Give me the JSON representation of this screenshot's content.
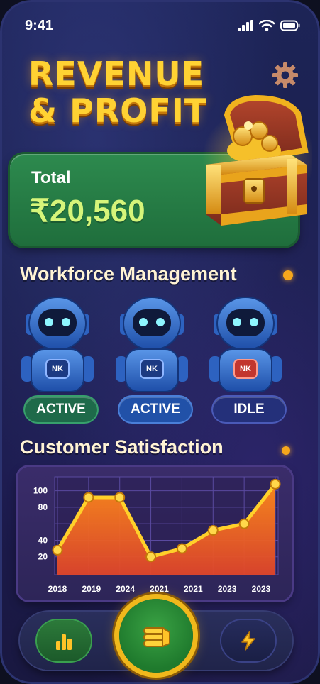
{
  "status_bar": {
    "time": "9:41"
  },
  "hero": {
    "title_line1": "REVENUE",
    "title_line2": "& PROFIT"
  },
  "total_card": {
    "label": "Total",
    "value": "₹20,560"
  },
  "workforce": {
    "title": "Workforce Management",
    "robots": [
      {
        "badge": "NK",
        "status": "ACTIVE",
        "status_color": "#1e6a4a",
        "badge_color": "#2c5fbf"
      },
      {
        "badge": "NK",
        "status": "ACTIVE",
        "status_color": "#2151a8",
        "badge_color": "#2c5fbf"
      },
      {
        "badge": "NK",
        "status": "IDLE",
        "status_color": "#24307a",
        "badge_color": "#c2362e"
      }
    ]
  },
  "satisfaction": {
    "title": "Customer Satisfaction"
  },
  "chart_data": {
    "type": "area",
    "categories": [
      "2018",
      "2019",
      "2024",
      "2021",
      "2021",
      "2023",
      "2023"
    ],
    "y_ticks": [
      20,
      40,
      80,
      100
    ],
    "series": [
      {
        "values": [
          28,
          92,
          92,
          20,
          30,
          52,
          60,
          108
        ]
      }
    ],
    "title": "",
    "xlabel": "",
    "ylabel": "",
    "grid": true
  },
  "colors": {
    "accent_gold": "#ffd233",
    "card_green": "#2d8a4e",
    "line_yellow": "#ffcc22",
    "area_orange": "#ff7a1a"
  },
  "bottom_nav": {
    "items": [
      {
        "icon": "bar-chart-icon"
      },
      {
        "icon": "coins-hand-icon"
      },
      {
        "icon": "lightning-icon"
      }
    ]
  }
}
